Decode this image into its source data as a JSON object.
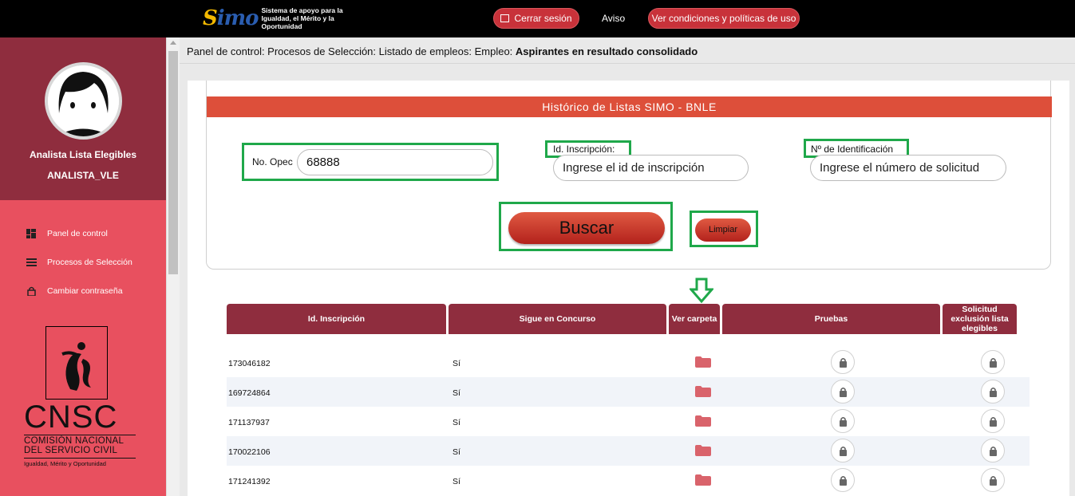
{
  "topbar": {
    "logo_mark_s": "S",
    "logo_mark_rest": "imo",
    "logo_text": "Sistema de apoyo para la Igualdad, el Mérito y la Oportunidad",
    "logout_label": "Cerrar sesión",
    "aviso_label": "Aviso",
    "conditions_label": "Ver condiciones y políticas de uso"
  },
  "sidebar": {
    "role": "Analista Lista Elegibles",
    "username": "ANALISTA_VLE",
    "menu": [
      {
        "label": "Panel de control",
        "icon": "dashboard-icon"
      },
      {
        "label": "Procesos de Selección",
        "icon": "list-icon"
      },
      {
        "label": "Cambiar contraseña",
        "icon": "lock-icon"
      }
    ],
    "org_acronym": "CNSC",
    "org_name_1": "COMISIÓN NACIONAL",
    "org_name_2": "DEL SERVICIO CIVIL",
    "org_tagline": "Igualdad, Mérito y Oportunidad"
  },
  "breadcrumb": {
    "path": "Panel de control: Procesos de Selección: Listado de empleos: Empleo: ",
    "current": "Aspirantes en resultado consolidado"
  },
  "search_panel": {
    "title": "Histórico de Listas SIMO - BNLE",
    "opec_label": "No. Opec",
    "opec_value": "68888",
    "inscripcion_label": "Id. Inscripción:",
    "inscripcion_placeholder": "Ingrese el id de inscripción",
    "identificacion_label": "Nº de Identificación",
    "identificacion_placeholder": "Ingrese el número de solicitud",
    "buscar_label": "Buscar",
    "limpiar_label": "Limpiar"
  },
  "colors": {
    "highlight": "#1fa84a",
    "header_red": "#dd4f3a",
    "table_header": "#8f2d3e",
    "sidebar": "#e8505f"
  },
  "table": {
    "headers": [
      "Id. Inscripción",
      "Sigue en Concurso",
      "Ver carpeta",
      "Pruebas",
      "Solicitud exclusión lista elegibles"
    ],
    "rows": [
      {
        "id": "173046182",
        "sigue": "Sí"
      },
      {
        "id": "169724864",
        "sigue": "Sí"
      },
      {
        "id": "171137937",
        "sigue": "Sí"
      },
      {
        "id": "170022106",
        "sigue": "Sí"
      },
      {
        "id": "171241392",
        "sigue": "Sí"
      }
    ]
  }
}
